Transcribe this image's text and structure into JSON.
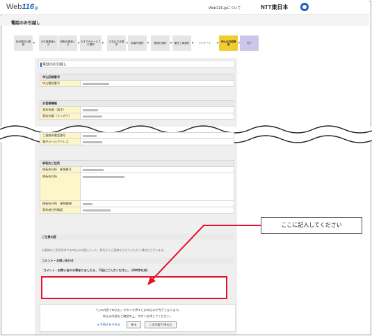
{
  "header": {
    "logo_text": "Web",
    "logo_num": "116",
    "logo_suffix": ".jp",
    "about_link": "Web116.jpについて",
    "ntt_text": "NTT東日本"
  },
  "page": {
    "title": "電話のお引越し"
  },
  "steps": [
    {
      "label": "利用規約の確認",
      "state": "normal"
    },
    {
      "label": "お住様情報入力",
      "state": "normal"
    },
    {
      "label": "移転先情報入力",
      "state": "normal"
    },
    {
      "label": "おすすめサービスの選択",
      "state": "normal"
    },
    {
      "label": "お支払方法選択",
      "state": "normal"
    },
    {
      "label": "新番号選択",
      "state": "normal"
    },
    {
      "label": "開通日選択",
      "state": "normal"
    },
    {
      "label": "撤去工事選択",
      "state": "normal"
    },
    {
      "label": "アンケート",
      "state": "normal"
    },
    {
      "label": "申込み内容確認",
      "state": "active"
    },
    {
      "label": "完了",
      "state": "done"
    }
  ],
  "section": {
    "title": "電話のお引越し"
  },
  "applicant": {
    "header": "申込回線番号",
    "rows": [
      {
        "label": "申込電話番号",
        "value": "▒▒▒-▒▒-▒▒▒"
      }
    ]
  },
  "customer": {
    "header": "お客様情報",
    "rows": [
      {
        "label": "契約名義（漢字）",
        "value": "▒▒▒"
      },
      {
        "label": "契約名義（フリガナ）",
        "value": "▒▒▒▒▒"
      },
      {
        "label": "ご連絡先電話番号",
        "value": "▒▒▒"
      },
      {
        "label": "電子メールアドレス",
        "value": "▒▒▒▒▒"
      }
    ]
  },
  "destination": {
    "header": "移転先ご住所",
    "rows": [
      {
        "label": "移転先住所　郵便番号",
        "value": "▒▒▒-▒▒▒▒"
      },
      {
        "label": "移転先住所",
        "value": "▒▒▒ ▒▒▒▒ ▒▒▒"
      },
      {
        "label": "移転先住所　建物種類",
        "value": "▒▒▒"
      },
      {
        "label": "契約者住所確認",
        "value": "▒▒▒▒▒"
      }
    ]
  },
  "notes": {
    "title": "ご注意内容",
    "text": "お客様のご利用条件やお申込み内容によって、弊社よりご連絡をさせていただく場合がございます。"
  },
  "comment": {
    "title": "コメント・お問い合わせ",
    "label": "コメント・お問い合わせ等ありましたら、下記にご入力ください。（200字以内）",
    "value": ""
  },
  "footer": {
    "line1": "「この内容で申込む」ボタンを押すとお申込みが完了となります。",
    "line2": "申込み内容をご確認の上、ボタンを押してください。",
    "cancel_link": "▸ 手続きをやめる",
    "back_button": "戻る",
    "submit_button": "この内容で申込む"
  },
  "callout": {
    "text": "ここに記入してください"
  },
  "colors": {
    "accent": "#1a63b8",
    "active_step": "#f0cd2d",
    "done_step": "#cdc6ea",
    "highlight": "#e8102b",
    "label_bg": "#fdf6c8"
  }
}
